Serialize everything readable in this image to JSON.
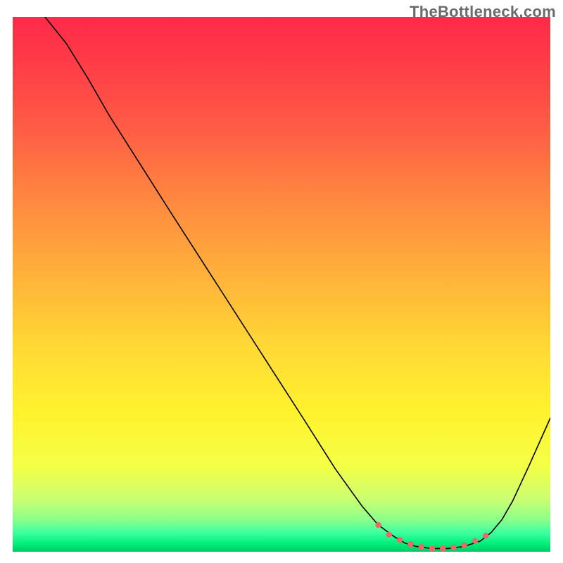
{
  "watermark": "TheBottleneck.com",
  "chart_data": {
    "type": "line",
    "title": "",
    "xlabel": "",
    "ylabel": "",
    "xlim": [
      0,
      100
    ],
    "ylim": [
      0,
      100
    ],
    "grid": false,
    "legend": false,
    "gradient_stops": [
      {
        "offset": 0.0,
        "color": "#ff2a49"
      },
      {
        "offset": 0.08,
        "color": "#ff3a48"
      },
      {
        "offset": 0.2,
        "color": "#ff5a45"
      },
      {
        "offset": 0.35,
        "color": "#ff8a40"
      },
      {
        "offset": 0.5,
        "color": "#ffb63a"
      },
      {
        "offset": 0.62,
        "color": "#ffd934"
      },
      {
        "offset": 0.74,
        "color": "#fff22e"
      },
      {
        "offset": 0.84,
        "color": "#f4ff46"
      },
      {
        "offset": 0.9,
        "color": "#ccff70"
      },
      {
        "offset": 0.94,
        "color": "#8cff8a"
      },
      {
        "offset": 0.965,
        "color": "#3cffa0"
      },
      {
        "offset": 0.985,
        "color": "#00ef7a"
      },
      {
        "offset": 1.0,
        "color": "#00c864"
      }
    ],
    "series": [
      {
        "name": "curve",
        "stroke": "#000000",
        "stroke_width": 1.6,
        "x": [
          6,
          10,
          14,
          18,
          24,
          30,
          38,
          46,
          54,
          60,
          65,
          68,
          71,
          73,
          75,
          78,
          81,
          84,
          87,
          89,
          91,
          93,
          96,
          100
        ],
        "y": [
          100,
          95,
          88.5,
          81.5,
          72,
          62.5,
          50,
          37.5,
          25,
          15.5,
          8.5,
          5,
          2.8,
          1.6,
          1.0,
          0.6,
          0.6,
          1.0,
          2.0,
          3.6,
          6.0,
          9.5,
          16,
          25
        ]
      },
      {
        "name": "highlight-dots",
        "stroke": "#ee6666",
        "marker_radius": 4.2,
        "x": [
          68,
          70,
          72,
          74,
          76,
          78,
          80,
          82,
          84,
          86,
          88
        ],
        "y": [
          5.0,
          3.2,
          2.2,
          1.4,
          0.9,
          0.6,
          0.6,
          0.8,
          1.2,
          2.0,
          3.0
        ]
      }
    ]
  }
}
